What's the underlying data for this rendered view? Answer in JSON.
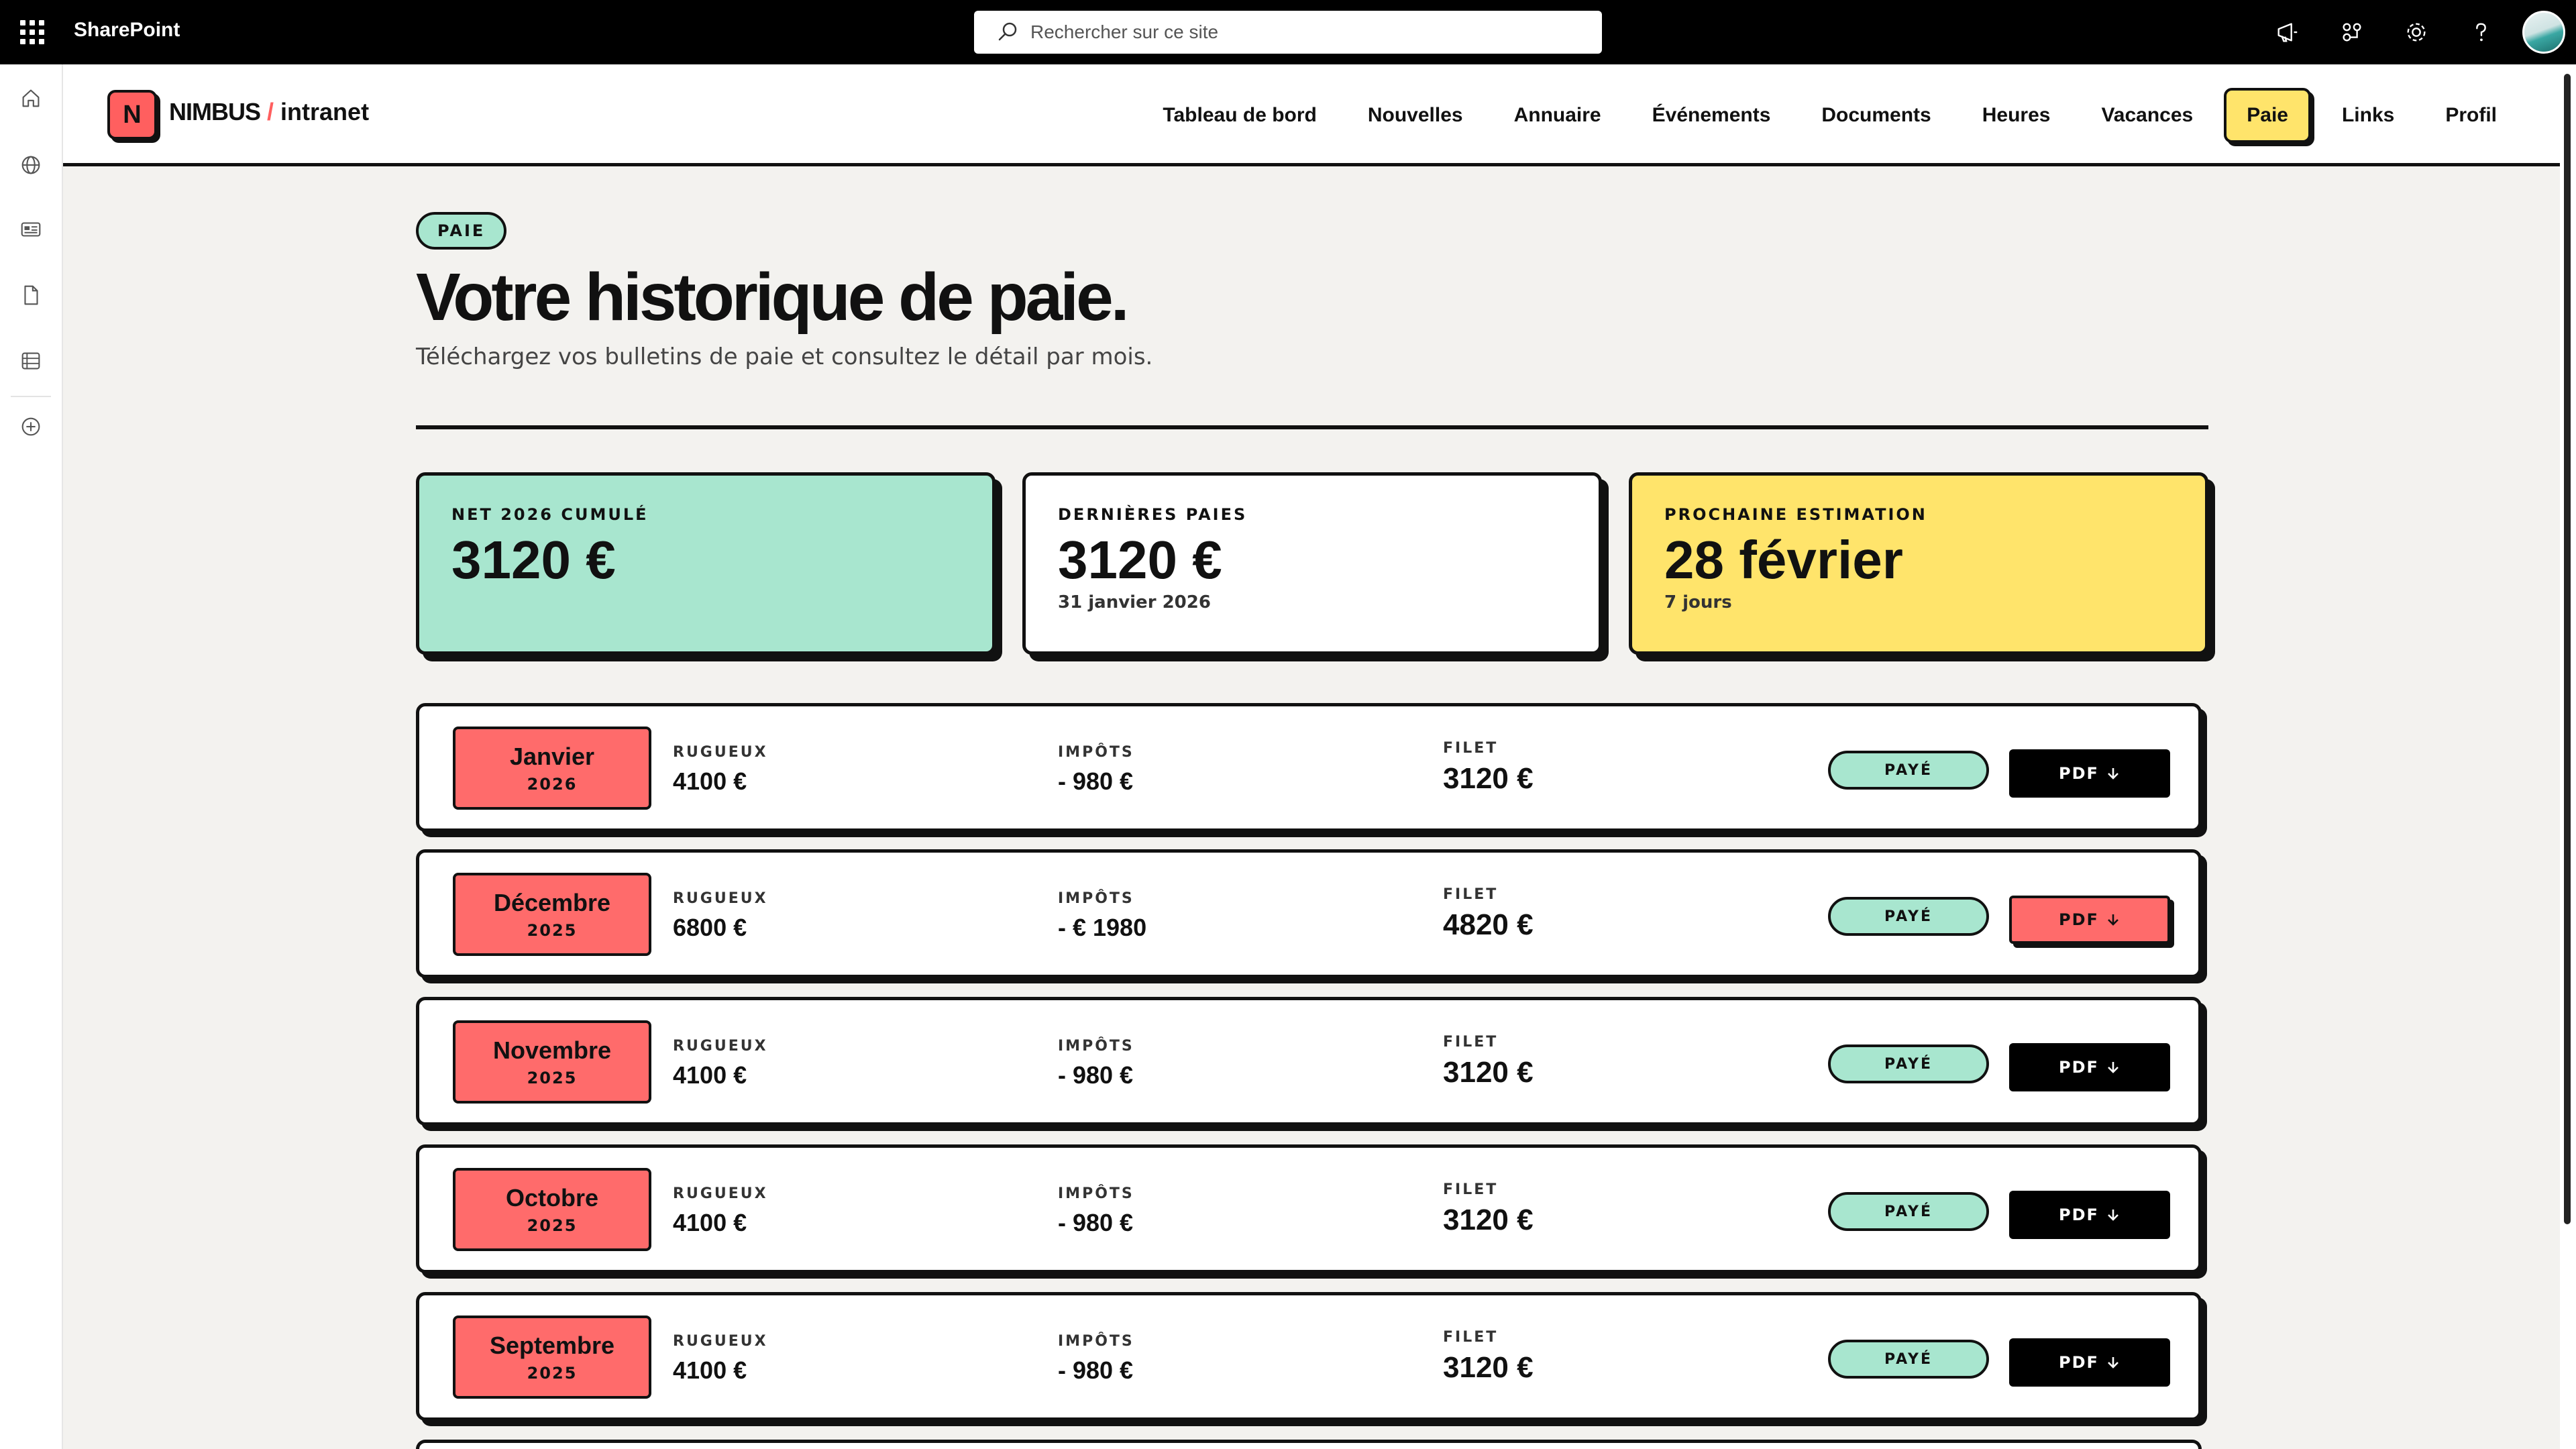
{
  "suite": {
    "brand": "SharePoint",
    "search_placeholder": "Rechercher sur ce site",
    "icons": [
      "megaphone-icon",
      "share-icon",
      "settings-icon",
      "help-icon",
      "avatar"
    ]
  },
  "site": {
    "logo_letter": "N",
    "logo_name": "NIMBUS",
    "logo_slash": "/",
    "logo_suffix": "intranet",
    "nav": [
      {
        "label": "Tableau de bord"
      },
      {
        "label": "Nouvelles"
      },
      {
        "label": "Annuaire"
      },
      {
        "label": "Événements"
      },
      {
        "label": "Documents"
      },
      {
        "label": "Heures"
      },
      {
        "label": "Vacances"
      },
      {
        "label": "Paie",
        "active": true
      },
      {
        "label": "Links"
      },
      {
        "label": "Profil"
      }
    ]
  },
  "page": {
    "tag": "PAIE",
    "title": "Votre historique de paie.",
    "subtitle": "Téléchargez vos bulletins de paie et consultez le détail par mois."
  },
  "summary": [
    {
      "label": "NET 2026 CUMULÉ",
      "value": "3120 €",
      "sub": ""
    },
    {
      "label": "DERNIÈRES PAIES",
      "value": "3120 €",
      "sub": "31 janvier 2026"
    },
    {
      "label": "PROCHAINE ESTIMATION",
      "value": "28 février",
      "sub": "7 jours"
    }
  ],
  "columns": {
    "gross": "RUGUEUX",
    "tax": "IMPÔTS",
    "net": "FILET"
  },
  "payslips": [
    {
      "month": "Janvier",
      "year": "2026",
      "gross": "4100 €",
      "tax": "- 980 €",
      "net": "3120 €",
      "status": "PAYÉ",
      "pdf": "PDF"
    },
    {
      "month": "Décembre",
      "year": "2025",
      "gross": "6800 €",
      "tax": "- € 1980",
      "net": "4820 €",
      "status": "PAYÉ",
      "pdf": "PDF"
    },
    {
      "month": "Novembre",
      "year": "2025",
      "gross": "4100 €",
      "tax": "- 980 €",
      "net": "3120 €",
      "status": "PAYÉ",
      "pdf": "PDF"
    },
    {
      "month": "Octobre",
      "year": "2025",
      "gross": "4100 €",
      "tax": "- 980 €",
      "net": "3120 €",
      "status": "PAYÉ",
      "pdf": "PDF"
    },
    {
      "month": "Septembre",
      "year": "2025",
      "gross": "4100 €",
      "tax": "- 980 €",
      "net": "3120 €",
      "status": "PAYÉ",
      "pdf": "PDF"
    }
  ],
  "colors": {
    "accent_red": "#ff6b6b",
    "accent_mint": "#a8e6cf",
    "accent_yellow": "#ffe46b",
    "ink": "#111111"
  }
}
